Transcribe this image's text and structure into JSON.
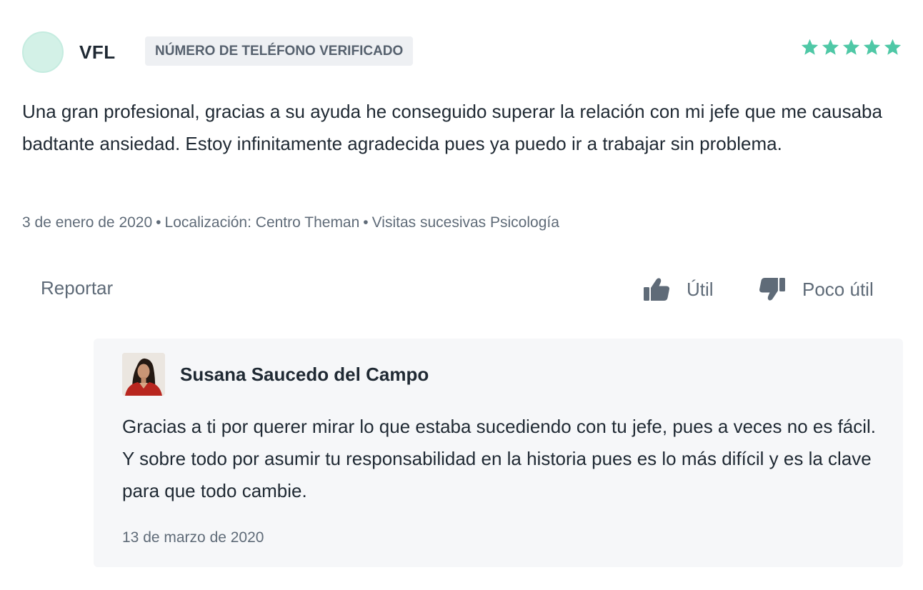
{
  "review": {
    "author": "VFL",
    "badge": "NÚMERO DE TELÉFONO VERIFICADO",
    "rating": 5,
    "rating_max": 5,
    "star_color": "#4fc8a6",
    "avatar_color": "#d3f1e7",
    "text": "Una gran profesional, gracias a su ayuda he conseguido superar la relación con mi jefe que me causaba badtante ansiedad. Estoy infinitamente agradecida pues ya puedo ir a trabajar sin problema.",
    "meta": {
      "date": "3 de enero de 2020",
      "separator": "•",
      "location": "Localización: Centro Theman",
      "visit_type": "Visitas sucesivas Psicología"
    },
    "actions": {
      "report": "Reportar",
      "useful": "Útil",
      "not_useful": "Poco útil",
      "useful_icon": "thumbs-up-icon",
      "not_useful_icon": "thumbs-down-icon"
    }
  },
  "reply": {
    "author": "Susana Saucedo del Campo",
    "photo": "doctor-photo",
    "text": "Gracias a ti por querer mirar lo que estaba sucediendo con tu jefe, pues a veces no es fácil. Y sobre todo por asumir tu responsabilidad en la historia pues es lo más difícil y es la clave para que todo cambie.",
    "date": "13 de marzo de 2020",
    "background": "#f6f7f9"
  }
}
